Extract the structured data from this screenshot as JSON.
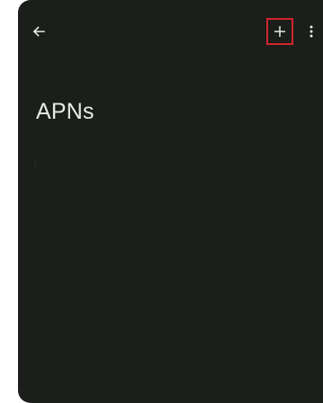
{
  "appbar": {
    "back_icon": "arrow-back-icon",
    "add_icon": "plus-icon",
    "more_icon": "more-vert-icon",
    "highlight_color": "#d0252c"
  },
  "page": {
    "title": "APNs",
    "background_color": "#1b1e1b",
    "text_color": "#e8ebe6"
  }
}
